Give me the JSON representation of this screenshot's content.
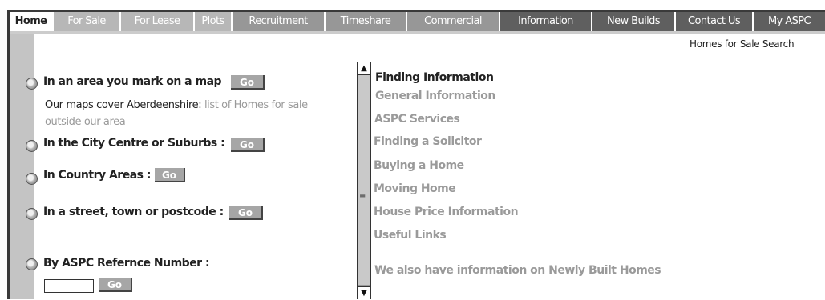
{
  "nav": {
    "tabs": [
      {
        "label": "Home"
      },
      {
        "label": "For Sale"
      },
      {
        "label": "For Lease"
      },
      {
        "label": "Plots"
      },
      {
        "label": "Recruitment"
      },
      {
        "label": "Timeshare"
      },
      {
        "label": "Commercial"
      },
      {
        "label": "Information"
      },
      {
        "label": "New Builds"
      },
      {
        "label": "Contact Us"
      },
      {
        "label": "My ASPC"
      }
    ]
  },
  "header": {
    "search_link": "Homes for Sale Search"
  },
  "search_options": {
    "map": {
      "title": "In an area you mark on a map",
      "go": "Go",
      "note_prefix": "Our maps cover Aberdeenshire: ",
      "note_link": "list of Homes for sale outside our area"
    },
    "city": {
      "title": "In the City Centre or Suburbs :",
      "go": "Go"
    },
    "country": {
      "title": "In Country Areas :",
      "go": "Go"
    },
    "street": {
      "title": "In a street, town or postcode :",
      "go": "Go"
    },
    "ref": {
      "title": "By ASPC Refernce Number :",
      "go": "Go",
      "value": ""
    }
  },
  "info": {
    "title": "Finding Information",
    "links": [
      {
        "label": "General Information"
      },
      {
        "label": "ASPC Services"
      },
      {
        "label": "Finding a Solicitor"
      },
      {
        "label": "Buying a Home"
      },
      {
        "label": "Moving Home"
      },
      {
        "label": "House Price Information"
      },
      {
        "label": "Useful Links"
      },
      {
        "label": "We also have information on Newly Built Homes"
      }
    ]
  },
  "scrollbar": {
    "up_icon": "triangle-up",
    "down_icon": "triangle-down",
    "grip_icon": "grip-lines"
  },
  "colors": {
    "nav_light": "#b7b7b7",
    "nav_mid": "#979797",
    "nav_dark": "#5f5f5f",
    "link_gray": "#9a9a9a",
    "go_button": "#a6a6a6"
  }
}
